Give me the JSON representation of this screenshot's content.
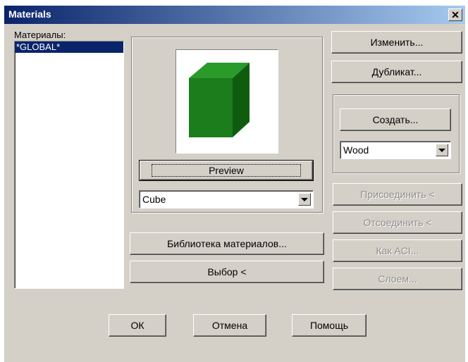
{
  "window": {
    "title": "Materials"
  },
  "materials": {
    "label": "Материалы:",
    "items": [
      "*GLOBAL*"
    ]
  },
  "preview": {
    "button_label": "Preview",
    "shape_value": "Cube"
  },
  "buttons": {
    "modify": "Изменить...",
    "duplicate": "Дубликат...",
    "new": "Создать...",
    "attach": "Присоединить <",
    "detach": "Отсоединить <",
    "by_aci": "Как ACI...",
    "by_layer": "Слоем...",
    "library": "Библиотека материалов...",
    "select": "Выбор <",
    "ok": "ОК",
    "cancel": "Отмена",
    "help": "Помощь"
  },
  "new_type": {
    "value": "Wood"
  },
  "colors": {
    "title_start": "#0a246a",
    "title_end": "#a6caf0",
    "selection": "#0a246a",
    "cube": "#1e8a1e"
  },
  "icons": {
    "close": "close-icon",
    "dropdown": "chevron-down-icon"
  }
}
